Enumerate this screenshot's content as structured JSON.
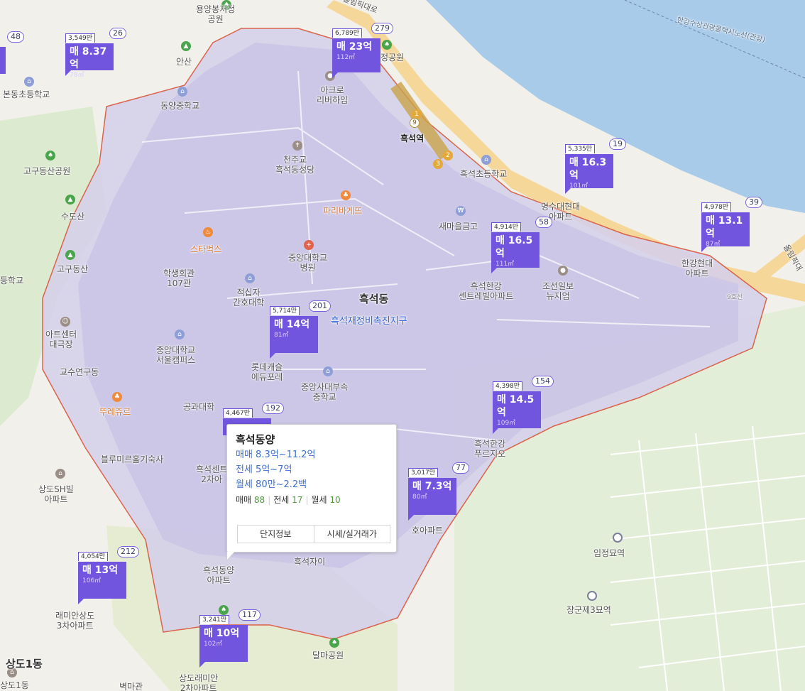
{
  "district": {
    "name": "흑석동",
    "zone": "흑석재정비촉진지구"
  },
  "stations": [
    {
      "name": "흑석역"
    }
  ],
  "line_badges": [
    "9",
    "1",
    "2",
    "3"
  ],
  "river_line_label": "한강수상관광콜택시노선(관광)",
  "road_labels": [
    "올림픽대로",
    "올림픽대",
    "9호선"
  ],
  "place_labels": [
    "용양봉저정\n공원",
    "정공원",
    "안산",
    "본동초등학교",
    "동양중학교",
    "아크로\n리버하임",
    "고구동산공원",
    "천주교\n흑석동성당",
    "흑석초등학교",
    "수도산",
    "파리바게뜨",
    "새마을금고",
    "명수대현대\n아파트",
    "한강현대\n아파트",
    "스타벅스",
    "중앙대학교\n병원",
    "고구동산",
    "학생회관\n107관",
    "등학교",
    "적십자\n간호대학",
    "흑석한강\n센트레빌아파트",
    "조선일보\n뉴지엄",
    "아트센터\n대극장",
    "중앙대학교\n서울캠퍼스",
    "롯데캐슬\n에듀포레",
    "교수연구동",
    "중앙사대부속\n중학교",
    "공과대학",
    "뚜레쥬르",
    "흑석한강\n푸르지오",
    "블루미르홀기숙사",
    "흑석센트\n2차아",
    "상도SH빌\n아파트",
    "호아파트",
    "흑석자이",
    "흑석동양\n아파트",
    "임정묘역",
    "래미안상도\n3차아파트",
    "장군제3묘역",
    "달마공원",
    "상도1동",
    "상도1동",
    "상도래미안\n2차아파트",
    "벽마관"
  ],
  "listings": [
    {
      "price": "3,549만",
      "count": "26",
      "main": "매 8.37억",
      "area": "78㎡"
    },
    {
      "price": "6,789만",
      "count": "279",
      "main": "매 23억",
      "area": "112㎡"
    },
    {
      "price": "5,335만",
      "count": "19",
      "main": "매 16.3억",
      "area": "101㎡"
    },
    {
      "price": "4,978만",
      "count": "39",
      "main": "매 13.1억",
      "area": "87㎡"
    },
    {
      "price": "4,914만",
      "count": "58",
      "main": "매 16.5억",
      "area": "111㎡"
    },
    {
      "price": "5,714만",
      "count": "201",
      "main": "매 14억",
      "area": "81㎡"
    },
    {
      "price": "4,398만",
      "count": "154",
      "main": "매 14.5억",
      "area": "109㎡"
    },
    {
      "price": "4,467만",
      "count": "192",
      "main": "",
      "area": ""
    },
    {
      "price": "3,017만",
      "count": "77",
      "main": "매 7.3억",
      "area": "80㎡"
    },
    {
      "price": "4,054만",
      "count": "212",
      "main": "매 13억",
      "area": "106㎡"
    },
    {
      "price": "3,241만",
      "count": "117",
      "main": "매 10억",
      "area": "102㎡"
    },
    {
      "price": "",
      "count": "48",
      "main": "",
      "area": ""
    }
  ],
  "popup": {
    "title": "흑석동양",
    "sale": "매매 8.3억~11.2억",
    "jeonse": "전세 5억~7억",
    "monthly": "월세 80만~2.2백",
    "counts": {
      "sale_label": "매매",
      "sale": "88",
      "jeonse_label": "전세",
      "jeonse": "17",
      "monthly_label": "월세",
      "monthly": "10"
    },
    "btn_info": "단지정보",
    "btn_price": "시세/실거래가"
  },
  "colors": {
    "marker": "#7155df",
    "district_fill": "#c9c3e6",
    "river": "#a9cbea",
    "boundary": "#d9553c"
  }
}
